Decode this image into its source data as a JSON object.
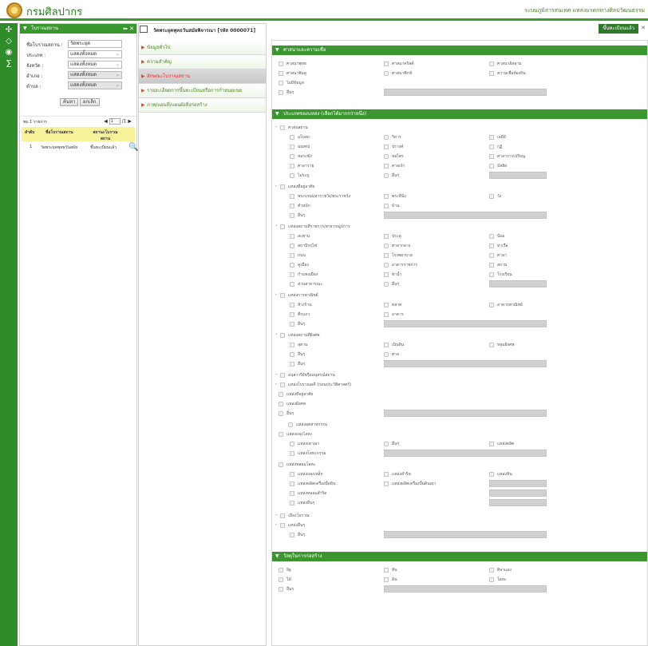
{
  "header": {
    "app_title": "กรมศิลปากร",
    "system_title": "ระบบภูมิสารสนเทศ แหล่งมรดกทางศิลปวัฒนธรรม"
  },
  "sidebar_rail": {
    "icons": [
      "tools-icon",
      "layers-icon",
      "globe-icon",
      "sigma-icon"
    ]
  },
  "search_panel": {
    "title": "โบราณสถาน",
    "fields": [
      {
        "label": "ชื่อโบราณสถาน :",
        "value": "วัดพระยุค"
      },
      {
        "label": "ประเภท :",
        "value": "แสดงทั้งหมด"
      },
      {
        "label": "จังหวัด :",
        "value": "แสดงทั้งหมด"
      },
      {
        "label": "อำเภอ :",
        "value": "แสดงทั้งหมด"
      },
      {
        "label": "ตำบล :",
        "value": "แสดงทั้งหมด"
      }
    ],
    "search_button": "ค้นหา",
    "reset_button": "ยกเลิก",
    "pager_text": "พบ 1 รายการ",
    "page_value": "1",
    "page_total": "/1",
    "columns": [
      "ลำดับ",
      "ชื่อโบราณสถาน",
      "สถานะโบราณสถาน"
    ],
    "results": [
      {
        "no": "1",
        "name": "วัดพระยุคพุทธวันสมัย",
        "status": "ขึ้นทะเบียนแล้ว"
      }
    ]
  },
  "document": {
    "title": "วัดพระยุคพุทธวันสมัยพิจารณา [รหัส 0000071]",
    "register_button": "ขึ้นทะเบียนแล้ว"
  },
  "section_menu": [
    {
      "label": "ข้อมูลทั่วไป",
      "active": false
    },
    {
      "label": "ความสำคัญ",
      "active": false
    },
    {
      "label": "ลักษณะโบราณสถาน",
      "active": true
    },
    {
      "label": "รายละเอียดการขึ้นทะเบียนหรือการกำหนดเขต",
      "active": false
    },
    {
      "label": "ภาพ/แผนที่/แผนผังสิ่งก่อสร้าง",
      "active": false
    }
  ],
  "sections": {
    "religion": {
      "title": "ศาสนาและความเชื่อ",
      "items": [
        "ศาสนาพุทธ",
        "ศาสนาคริสต์",
        "ศาสนาอิสลาม",
        "ศาสนาฮินดู",
        "ศาสนาซิกข์",
        "ความเชื่อท้องถิ่น",
        "ไม่มีข้อมูล",
        "อื่นๆ"
      ]
    },
    "site_type": {
      "title": "ประเภทของแหล่ง (เลือกได้มากกว่าหนึ่ง)",
      "groups": [
        {
          "title": "ศาสนสถาน",
          "items": [
            "อุโบสถ",
            "วิหาร",
            "เจดีย์",
            "มณฑป",
            "ปรางค์",
            "กุฏิ",
            "หอระฆัง",
            "หอไตร",
            "ศาลาการเปรียญ",
            "ศาลาราย",
            "ศาลเจ้า",
            "มัสยิด",
            "ไม่ระบุ",
            "อื่นๆ"
          ]
        },
        {
          "title": "แหล่งที่อยู่อาศัย",
          "items": [
            "พระบรมมหาราชวัง/พระราชวัง",
            "พระที่นั่ง",
            "วัง",
            "ตำหนัก",
            "บ้าน",
            "อื่นๆ"
          ]
        },
        {
          "title": "แหล่งสถานที่ราชการ/สาธารณูปการ",
          "items": [
            "สะพาน",
            "ประตู",
            "ป้อม",
            "สถานีรถไฟ",
            "ศาลากลาง",
            "ท่าเรือ",
            "ถนน",
            "โรงพยาบาล",
            "ศาลา",
            "คูเมือง",
            "อาคารราชการ",
            "สถาน",
            "กำแพงเมือง",
            "ท่าน้ำ",
            "โรงเรียน",
            "ส่วนสาธารณะ",
            "อื่นๆ"
          ]
        },
        {
          "title": "แหล่งการพาณิชย์",
          "items": [
            "ห้างร้าน",
            "ตลาด",
            "อาคารพาณิชย์",
            "ตึกแถว",
            "อาคาร",
            "อื่นๆ"
          ]
        },
        {
          "title": "แหล่งสถานที่ฝังศพ",
          "items": [
            "สุสาน",
            "เนินดิน",
            "หลุมฝังศพ",
            "อื่นๆ",
            "ศาล",
            "อื่นๆ"
          ]
        },
        {
          "title": "อนุสาวรีย์หรืออนุสรณ์สถาน",
          "items": []
        },
        {
          "title": "แหล่งโบราณคดี (ก่อนประวัติศาสตร์)",
          "items": [
            "แหล่งที่อยู่อาศัย",
            "แหล่งฝังศพ",
            "อื่นๆ",
            "แหล่งอุตสาหกรรม",
            "แหล่งถลุงโลหะ",
            "แหล่งเตาเผา",
            "อื่นๆ",
            "แหล่งผลิต",
            "แหล่งโลหะกรรม",
            "แหล่งหลอมโลหะ",
            "แหล่งถลุงเหล็ก",
            "แหล่งสำริด",
            "แหล่งหิน",
            "แหล่งผลิตเครื่องมือหิน",
            "แหล่งผลิตเครื่องปั้นดินเผา",
            "แหล่งหลอมสำริด",
            "แหล่งอื่นๆ"
          ]
        },
        {
          "title": "เมืองโบราณ",
          "items": []
        },
        {
          "title": "แหล่งอื่นๆ",
          "items": [
            "อื่นๆ"
          ]
        }
      ]
    },
    "materials": {
      "title": "วัสดุในการก่อสร้าง",
      "items": [
        "อิฐ",
        "หิน",
        "ศิลาแลง",
        "ไม้",
        "ดิน",
        "โลหะ",
        "อื่นๆ"
      ]
    }
  }
}
